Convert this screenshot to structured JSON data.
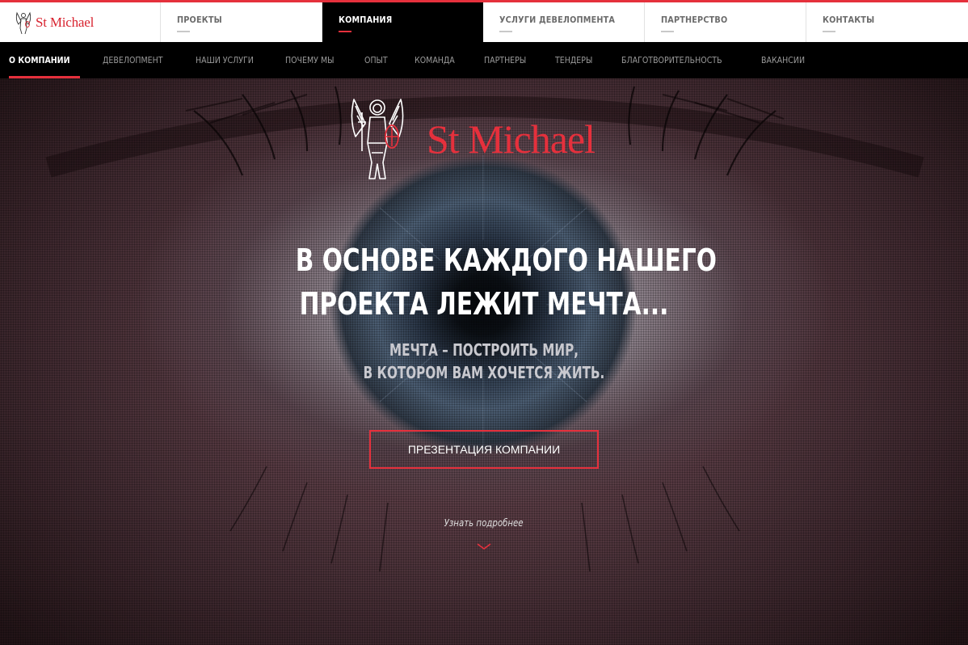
{
  "brand": {
    "name": "St Michael",
    "color": "#e5303c"
  },
  "topnav": {
    "items": [
      {
        "label": "ПРОЕКТЫ",
        "active": false
      },
      {
        "label": "КОМПАНИЯ",
        "active": true
      },
      {
        "label": "УСЛУГИ ДЕВЕЛОПМЕНТА",
        "active": false
      },
      {
        "label": "ПАРТНЕРСТВО",
        "active": false
      },
      {
        "label": "КОНТАКТЫ",
        "active": false
      }
    ]
  },
  "subnav": {
    "items": [
      {
        "label": "О КОМПАНИИ",
        "active": true
      },
      {
        "label": "ДЕВЕЛОПМЕНТ",
        "active": false
      },
      {
        "label": "НАШИ УСЛУГИ",
        "active": false
      },
      {
        "label": "ПОЧЕМУ МЫ",
        "active": false
      },
      {
        "label": "ОПЫТ",
        "active": false
      },
      {
        "label": "КОМАНДА",
        "active": false
      },
      {
        "label": "ПАРТНЕРЫ",
        "active": false
      },
      {
        "label": "ТЕНДЕРЫ",
        "active": false
      },
      {
        "label": "БЛАГОТВОРИТЕЛЬНОСТЬ",
        "active": false
      },
      {
        "label": "ВАКАНСИИ",
        "active": false
      }
    ]
  },
  "hero": {
    "logo_text": "St Michael",
    "headline_line1": "В ОСНОВЕ КАЖДОГО НАШЕГО",
    "headline_line2": "ПРОЕКТА ЛЕЖИТ МЕЧТА...",
    "subline_line1": "МЕЧТА – ПОСТРОИТЬ МИР,",
    "subline_line2": "В КОТОРОМ ВАМ ХОЧЕТСЯ ЖИТЬ.",
    "cta_label": "ПРЕЗЕНТАЦИЯ КОМПАНИИ",
    "more_label": "Узнать подробнее"
  },
  "icons": {
    "brand_emblem": "archangel-emblem-icon",
    "scroll_hint": "chevron-down-icon"
  }
}
